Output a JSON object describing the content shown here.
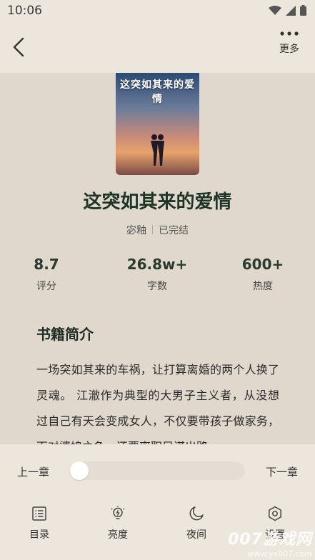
{
  "status_bar": {
    "time": "10:06"
  },
  "app_bar": {
    "more_label": "更多"
  },
  "book": {
    "cover_title": "这突如其来的爱情",
    "title": "这突如其来的爱情",
    "author": "宓釉",
    "status": "已完结"
  },
  "stats": [
    {
      "value": "8.7",
      "label": "评分"
    },
    {
      "value": "26.8w+",
      "label": "字数"
    },
    {
      "value": "600+",
      "label": "热度"
    }
  ],
  "intro": {
    "title": "书籍简介",
    "text": "一场突如其来的车祸，让打算离婚的两个人换了灵魂。 江澈作为典型的大男子主义者，从没想过自己有天会变成女人，不仅要带孩子做家务，面对婆媳之争，还要离职另谋出路。"
  },
  "reader_nav": {
    "prev_label": "上一章",
    "next_label": "下一章",
    "progress": 0
  },
  "toolbar": {
    "items": [
      {
        "label": "目录",
        "icon": "list-icon"
      },
      {
        "label": "亮度",
        "icon": "brightness-icon"
      },
      {
        "label": "夜间",
        "icon": "moon-icon"
      },
      {
        "label": "设置",
        "icon": "settings-icon"
      }
    ]
  },
  "watermark": {
    "main": "007游戏网",
    "sub": "www.yx007.com"
  }
}
